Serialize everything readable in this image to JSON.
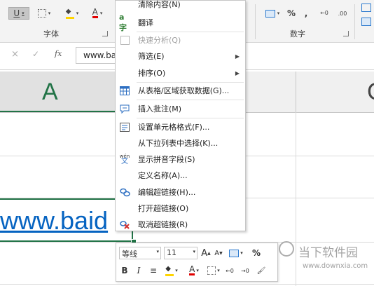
{
  "ribbon": {
    "font_group_label": "字体",
    "number_group_label": "数字",
    "underline_label": "U",
    "font_color_label": "A",
    "percent_label": "%",
    "comma_label": ","
  },
  "formula_bar": {
    "cancel_glyph": "×",
    "enter_glyph": "✓",
    "fx_label": "fx",
    "content": "www.ba"
  },
  "sheet": {
    "column_a": "A",
    "column_next": "C",
    "cell_link_text": "www.baid"
  },
  "context_menu": {
    "items": [
      {
        "label": "清除内容(N)",
        "enabled": true
      },
      {
        "label": "翻译",
        "enabled": true,
        "icon": "translate-icon"
      },
      {
        "label": "快速分析(Q)",
        "enabled": false,
        "icon": "quick-analysis-icon"
      },
      {
        "label": "筛选(E)",
        "enabled": true,
        "submenu": true
      },
      {
        "label": "排序(O)",
        "enabled": true,
        "submenu": true
      },
      {
        "label": "从表格/区域获取数据(G)...",
        "enabled": true,
        "icon": "table-icon"
      },
      {
        "label": "插入批注(M)",
        "enabled": true,
        "icon": "comment-icon"
      },
      {
        "label": "设置单元格格式(F)...",
        "enabled": true,
        "icon": "format-cells-icon"
      },
      {
        "label": "从下拉列表中选择(K)...",
        "enabled": true
      },
      {
        "label": "显示拼音字段(S)",
        "enabled": true,
        "icon": "phonetic-icon"
      },
      {
        "label": "定义名称(A)...",
        "enabled": true
      },
      {
        "label": "编辑超链接(H)...",
        "enabled": true,
        "icon": "hyperlink-icon"
      },
      {
        "label": "打开超链接(O)",
        "enabled": true
      },
      {
        "label": "取消超链接(R)",
        "enabled": true,
        "icon": "remove-link-icon"
      }
    ]
  },
  "mini_toolbar": {
    "font_name": "等线",
    "font_size": "11",
    "grow_font": "A",
    "shrink_font": "A",
    "percent": "%",
    "bold": "B",
    "italic": "I",
    "font_color": "A",
    "comma": ","
  },
  "watermark": {
    "title": "当下软件园",
    "url": "www.downxia.com"
  },
  "colors": {
    "excel_green": "#217346",
    "link_blue": "#0563c1",
    "menu_border": "#c6c6c6"
  }
}
